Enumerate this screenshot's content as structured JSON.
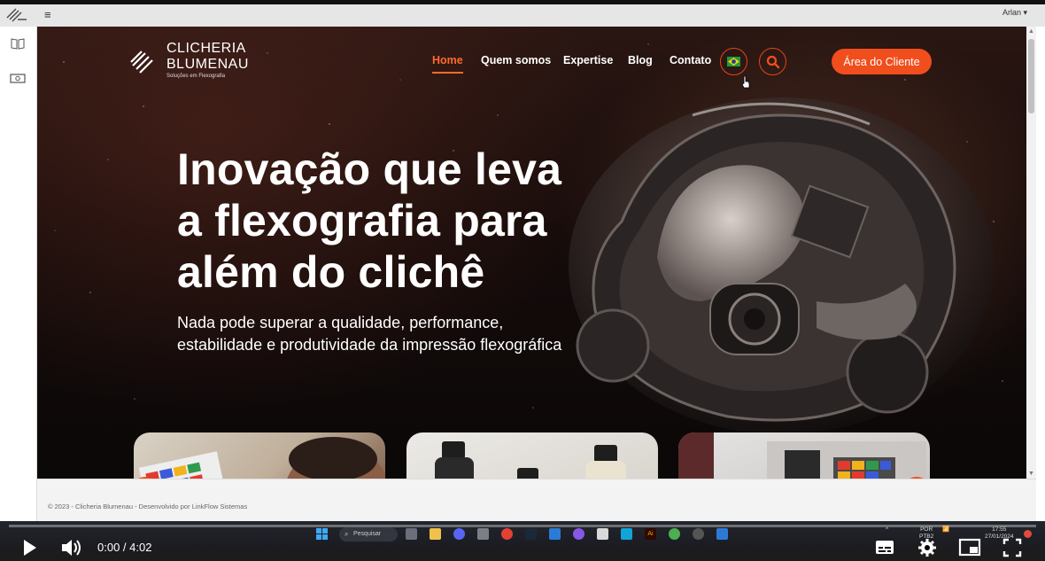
{
  "admin_bar": {
    "user_label": "Arlan",
    "menu_icon": "hamburger-menu-icon"
  },
  "sidebar": {
    "items": [
      {
        "icon": "book-icon"
      },
      {
        "icon": "money-icon"
      }
    ]
  },
  "site": {
    "brand": {
      "line1": "CLICHERIA",
      "line2": "BLUMENAU",
      "tagline": "Soluções em Flexografia"
    },
    "nav": [
      {
        "label": "Home",
        "active": true
      },
      {
        "label": "Quem somos",
        "active": false
      },
      {
        "label": "Expertise",
        "active": false
      },
      {
        "label": "Blog",
        "active": false
      },
      {
        "label": "Contato",
        "active": false
      }
    ],
    "language_button_icon": "brazil-flag-icon",
    "search_button_icon": "search-icon",
    "client_button_label": "Área do Cliente",
    "hero": {
      "title_lines": [
        "Inovação que leva",
        "a flexografia para",
        "além do clichê"
      ],
      "subtitle_lines": [
        "Nada pode superar a qualidade, performance,",
        "estabilidade e produtividade da impressão flexográfica"
      ]
    },
    "footer_text": "© 2023 - Clicheria Blumenau - Desenvolvido por LinkFlow Sistemas",
    "accent_color": "#f04e1c"
  },
  "taskbar": {
    "search_placeholder": "Pesquisar",
    "lang_top": "POR",
    "lang_bottom": "PTB2",
    "clock_time": "17:55",
    "clock_date": "27/01/2024"
  },
  "player": {
    "time_display": "0:00 / 4:02",
    "progress_fraction": 0.0
  }
}
